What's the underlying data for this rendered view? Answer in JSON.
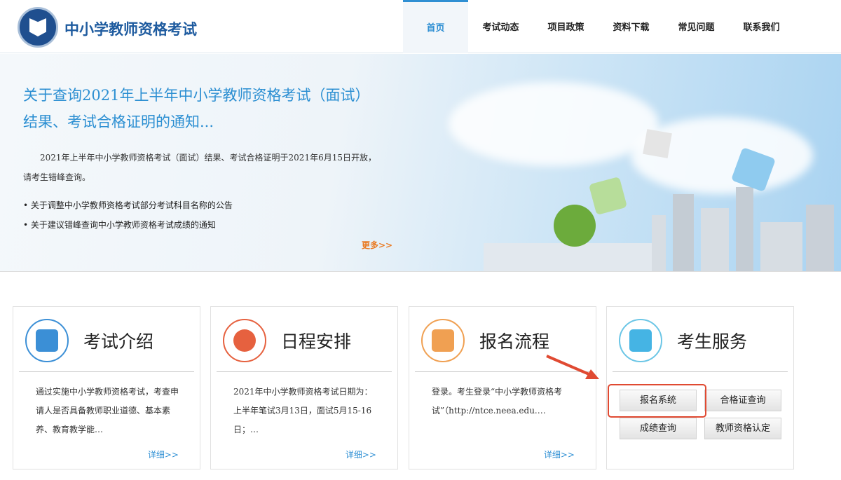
{
  "header": {
    "site_title": "中小学教师资格考试",
    "nav": [
      "首页",
      "考试动态",
      "项目政策",
      "资料下载",
      "常见问题",
      "联系我们"
    ]
  },
  "banner": {
    "title": "关于查询2021年上半年中小学教师资格考试（面试）结果、考试合格证明的通知...",
    "paragraph": "2021年上半年中小学教师资格考试（面试）结果、考试合格证明于2021年6月15日开放，请考生错峰查询。",
    "links": [
      "关于调整中小学教师资格考试部分考试科目名称的公告",
      "关于建议错峰查询中小学教师资格考试成绩的通知"
    ],
    "more": "更多>>"
  },
  "cards": [
    {
      "title": "考试介绍",
      "text": "通过实施中小学教师资格考试，考查申请人是否具备教师职业道德、基本素养、教育教学能…",
      "more": "详细>>"
    },
    {
      "title": "日程安排",
      "text": "2021年中小学教师资格考试日期为：上半年笔试3月13日，面试5月15-16日；…",
      "more": "详细>>"
    },
    {
      "title": "报名流程",
      "text": "登录。考生登录“中小学教师资格考试”（http://ntce.neea.edu.…",
      "more": "详细>>"
    },
    {
      "title": "考生服务",
      "buttons": [
        "报名系统",
        "合格证查询",
        "成绩查询",
        "教师资格认定"
      ]
    }
  ]
}
